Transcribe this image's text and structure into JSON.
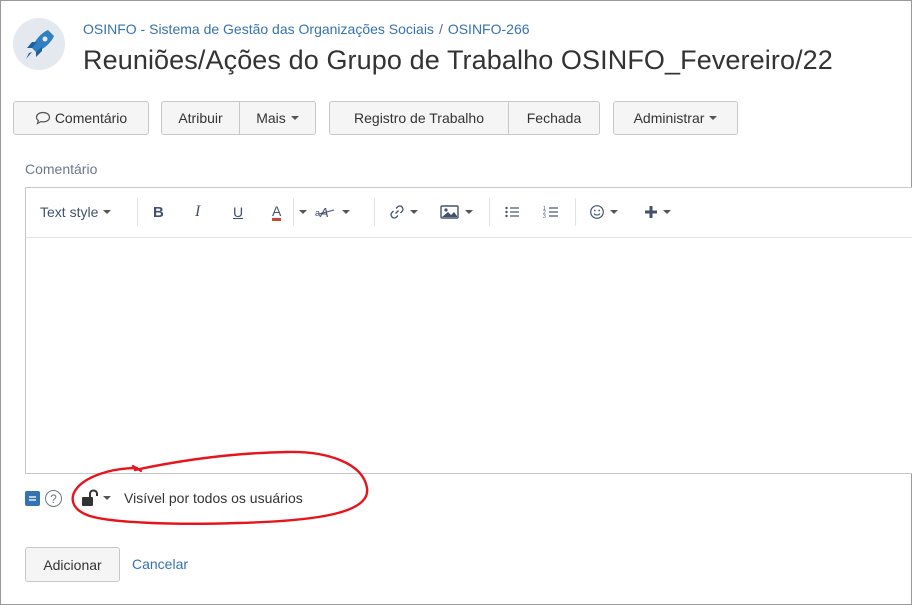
{
  "header": {
    "project_name": "OSINFO - Sistema de Gestão das Organizações Sociais",
    "separator": "/",
    "issue_key": "OSINFO-266",
    "title": "Reuniões/Ações do Grupo de Trabalho OSINFO_Fevereiro/22"
  },
  "toolbar": {
    "comment_label": "Comentário",
    "assign_label": "Atribuir",
    "more_label": "Mais",
    "log_work_label": "Registro de Trabalho",
    "closed_label": "Fechada",
    "admin_label": "Administrar"
  },
  "comment": {
    "label": "Comentário",
    "text_style_label": "Text style",
    "bold": "B",
    "italic": "I",
    "underline": "U",
    "text_color": "A",
    "body": ""
  },
  "security": {
    "visibility_label": "Visível por todos os usuários"
  },
  "actions": {
    "add_label": "Adicionar",
    "cancel_label": "Cancelar"
  },
  "colors": {
    "link": "#3572b0",
    "annotation": "#e8141c",
    "text_color_underline": "#d04437"
  }
}
